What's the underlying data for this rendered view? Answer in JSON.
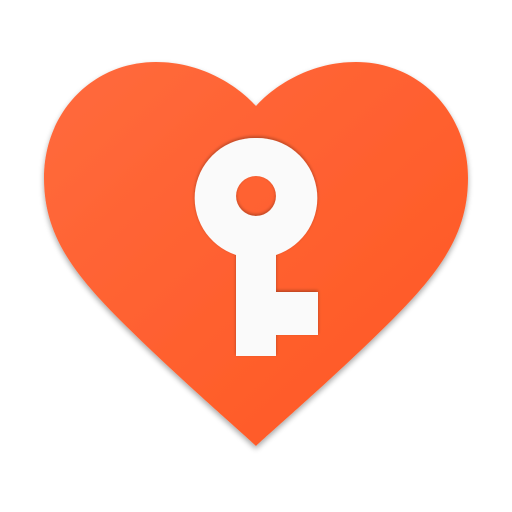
{
  "app_icon": {
    "name": "heart-key",
    "colors": {
      "heart_fill_top": "#ff6a3d",
      "heart_fill_bottom": "#ff5722",
      "heart_shadow": "#c9421a",
      "key_fill": "#fafafa",
      "key_shadow": "#d8d8d8",
      "background": "#ffffff"
    },
    "icons": [
      "heart-icon",
      "key-icon"
    ]
  }
}
